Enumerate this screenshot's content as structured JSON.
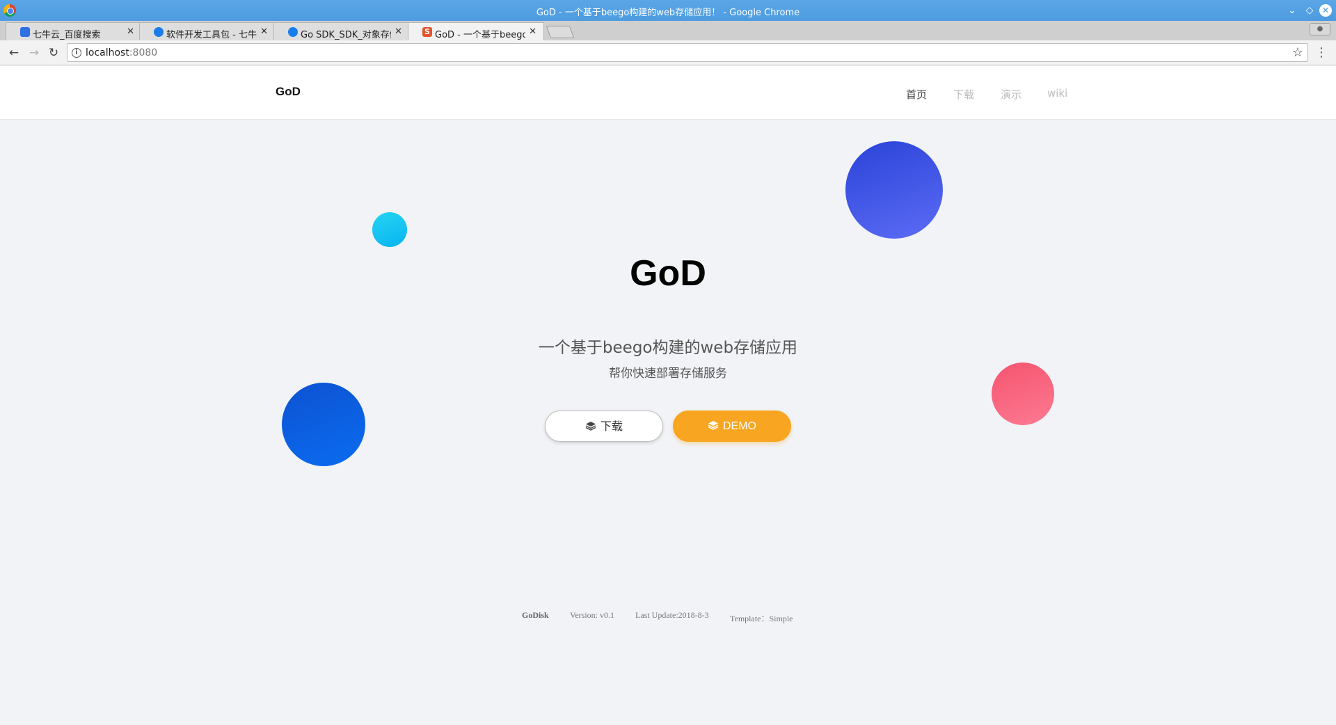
{
  "browser": {
    "window_title": "GoD - 一个基于beego构建的web存储应用！ - Google Chrome",
    "tabs": [
      {
        "label": "七牛云_百度搜索",
        "close": "✕"
      },
      {
        "label": "软件开发工具包 - 七牛云",
        "close": "✕"
      },
      {
        "label": "Go SDK_SDK_对象存储",
        "close": "✕"
      },
      {
        "label": "GoD - 一个基于beego构建",
        "close": "✕",
        "active": true
      }
    ],
    "url_host": "localhost",
    "url_port": ":8080"
  },
  "header": {
    "logo": "GoD",
    "nav": [
      "首页",
      "下载",
      "演示",
      "wiki"
    ]
  },
  "hero": {
    "title": "GoD",
    "subtitle": "一个基于beego构建的web存储应用",
    "tagline": "帮你快速部署存储服务",
    "download_label": "下载",
    "demo_label": "DEMO"
  },
  "footer": {
    "brand": "GoDisk",
    "version": "Version: v0.1",
    "update": "Last Update:2018-8-3",
    "template": "Template：Simple"
  },
  "colors": {
    "accent_orange": "#f8a621",
    "page_bg": "#f1f3f7",
    "blob_cyan": "#07b4f0",
    "blob_indigo": "#3b4ee6",
    "blob_blue": "#0a5fe2",
    "blob_pink": "#f9627d"
  }
}
